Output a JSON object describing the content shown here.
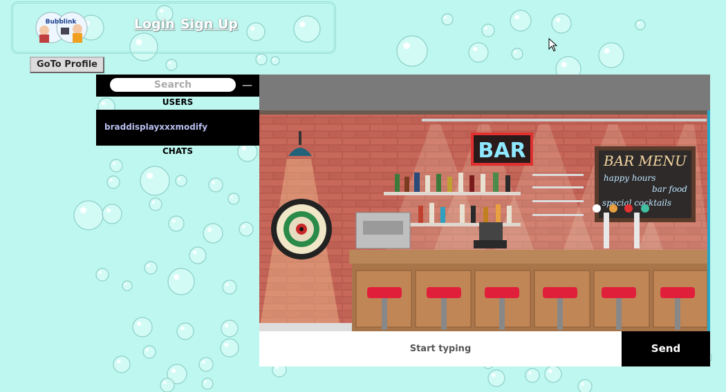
{
  "header": {
    "logo_text": "Bubblink",
    "login_label": "Login",
    "signup_label": "Sign Up",
    "goto_profile_label": "GoTo Profile"
  },
  "sidebar": {
    "search_placeholder": "Search",
    "users_label": "USERS",
    "users": [
      {
        "name": "braddisplayxxxmodify"
      }
    ],
    "chats_label": "CHATS"
  },
  "chat": {
    "scene": {
      "bar_sign": "BAR",
      "menu_title": "BAR MENU",
      "menu_lines": [
        "happy hours",
        "bar food",
        "special cocktails"
      ]
    },
    "input_placeholder": "Start typing",
    "send_label": "Send"
  },
  "colors": {
    "background": "#bdf7ef",
    "panel": "#000000",
    "chat_header": "#7a7a7a"
  }
}
